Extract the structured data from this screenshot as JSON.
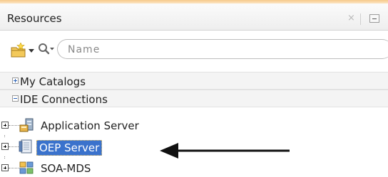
{
  "panel": {
    "title": "Resources",
    "close_glyph": "×"
  },
  "toolbar": {
    "new_icon": "new-folder-icon",
    "search_icon": "search-icon",
    "search_placeholder": "Name"
  },
  "catalogs": [
    {
      "label": "My Catalogs",
      "expand_glyph": "plus-box-icon"
    },
    {
      "label": "IDE Connections",
      "expand_glyph": "minus-box-icon"
    }
  ],
  "tree": [
    {
      "label": "Application Server",
      "icon": "application-server-icon",
      "selected": false
    },
    {
      "label": "OEP Server",
      "icon": "oep-server-icon",
      "selected": true
    },
    {
      "label": "SOA-MDS",
      "icon": "soa-mds-icon",
      "selected": false
    }
  ],
  "colors": {
    "accent": "#f6c98a",
    "selection": "#3a72cc",
    "arrow": "#000000"
  }
}
